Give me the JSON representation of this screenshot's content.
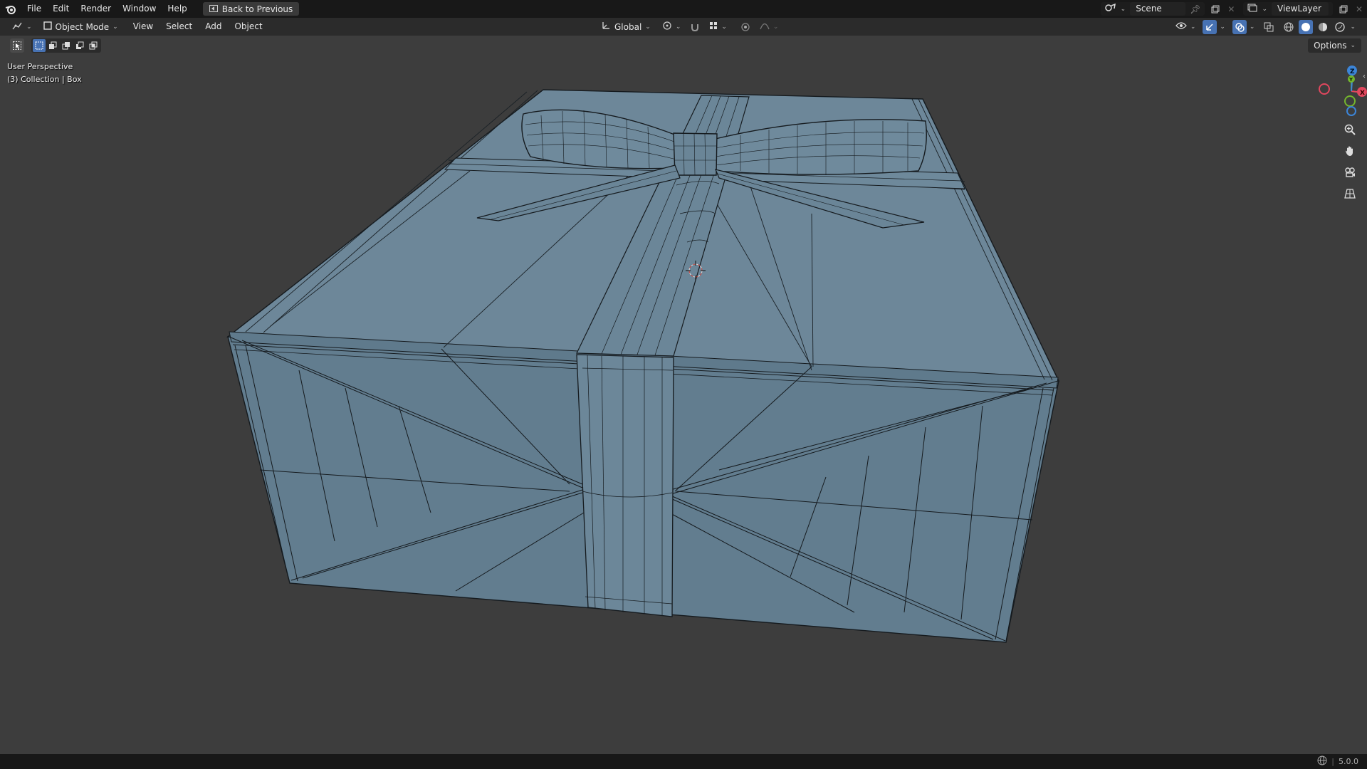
{
  "topbar": {
    "menus": [
      "File",
      "Edit",
      "Render",
      "Window",
      "Help"
    ],
    "back_label": "Back to Previous",
    "scene_name": "Scene",
    "view_layer_name": "ViewLayer"
  },
  "viewport_header": {
    "mode_label": "Object Mode",
    "menus": [
      "View",
      "Select",
      "Add",
      "Object"
    ],
    "transform_orientation": "Global"
  },
  "tool_row": {
    "options_label": "Options"
  },
  "viewport_info": {
    "perspective": "User Perspective",
    "collection": "(3) Collection | Box"
  },
  "gizmo": {
    "axes": [
      "X",
      "Y",
      "Z"
    ],
    "colors": {
      "x": "#e0475e",
      "y": "#74b62d",
      "z": "#3c85d8"
    }
  },
  "statusbar": {
    "version": "5.0.0"
  },
  "colors": {
    "mesh_fill": "#6f8a9c",
    "wire": "#151a1e",
    "background": "#3d3d3d",
    "accent": "#4772b3"
  }
}
